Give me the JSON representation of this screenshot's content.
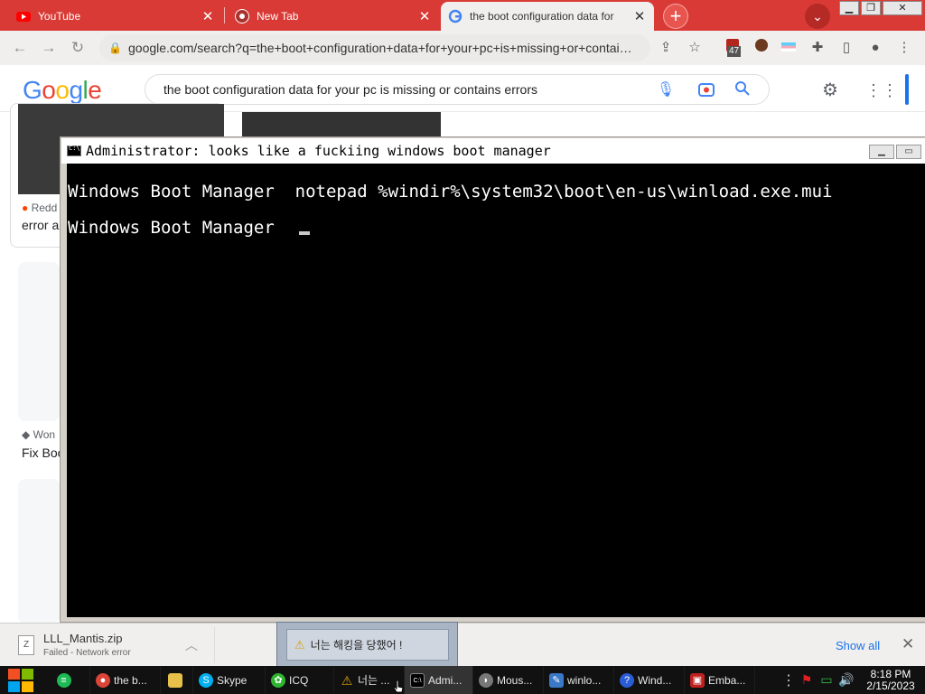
{
  "tabs": [
    {
      "title": "YouTube",
      "icon": "youtube-icon"
    },
    {
      "title": "New Tab",
      "icon": "chrome-icon"
    },
    {
      "title": "the boot configuration data for",
      "icon": "google-icon",
      "active": true
    }
  ],
  "toolbar": {
    "url": "google.com/search?q=the+boot+configuration+data+for+your+pc+is+missing+or+contai…",
    "extension_badge": "47"
  },
  "google": {
    "logo_letters": [
      "G",
      "o",
      "o",
      "g",
      "l",
      "e"
    ],
    "logo_colors": [
      "#4285f4",
      "#ea4335",
      "#fbbc05",
      "#4285f4",
      "#34a853",
      "#ea4335"
    ],
    "query": "the boot configuration data for your pc is missing or contains errors"
  },
  "background_results": {
    "card1_source": "Redd",
    "card1_title": "error a",
    "card2_source": "Won",
    "card2_title": "Fix Boo"
  },
  "cmd": {
    "title": "Administrator:  looks like a fuckiing windows boot manager",
    "lines": [
      "Windows Boot Manager  notepad %windir%\\system32\\boot\\en-us\\winload.exe.mui",
      "Windows Boot Manager  "
    ]
  },
  "download": {
    "filename": "LLL_Mantis.zip",
    "status": "Failed - Network error",
    "show_all": "Show all"
  },
  "popup": {
    "message": "너는 해킹을 당했어 !"
  },
  "taskbar": {
    "items": [
      {
        "label": "",
        "icon": "spotify-icon",
        "color": "#1db954"
      },
      {
        "label": "the b...",
        "icon": "chrome-icon",
        "color": "#db4437"
      },
      {
        "label": "",
        "icon": "folder-icon",
        "color": "#e8c04a"
      },
      {
        "label": "Skype",
        "icon": "skype-icon",
        "color": "#00aff0"
      },
      {
        "label": "ICQ",
        "icon": "icq-icon",
        "color": "#2fb52f"
      },
      {
        "label": "너는 ...",
        "icon": "warning-icon",
        "color": "#d8a000"
      },
      {
        "label": "Admi...",
        "icon": "cmd-icon",
        "color": "#000000",
        "active": true
      },
      {
        "label": "Mous...",
        "icon": "mouse-icon",
        "color": "#777777"
      },
      {
        "label": "winlo...",
        "icon": "notepad-icon",
        "color": "#3a78c8"
      },
      {
        "label": "Wind...",
        "icon": "help-icon",
        "color": "#2a5cd6"
      },
      {
        "label": "Emba...",
        "icon": "app-icon",
        "color": "#c02020"
      }
    ],
    "clock_time": "8:18 PM",
    "clock_date": "2/15/2023"
  }
}
